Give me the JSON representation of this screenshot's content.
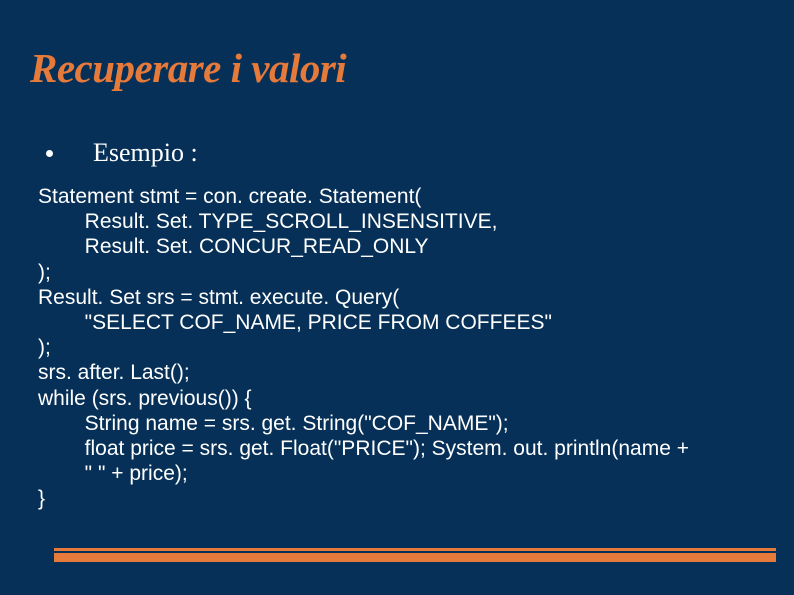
{
  "title": "Recuperare i valori",
  "bullet": "Esempio :",
  "code": "Statement stmt = con. create. Statement(\n        Result. Set. TYPE_SCROLL_INSENSITIVE,\n        Result. Set. CONCUR_READ_ONLY\n);\nResult. Set srs = stmt. execute. Query(\n        \"SELECT COF_NAME, PRICE FROM COFFEES\"\n);\nsrs. after. Last();\nwhile (srs. previous()) {\n        String name = srs. get. String(\"COF_NAME\");\n        float price = srs. get. Float(\"PRICE\"); System. out. println(name +\n        \" \" + price);\n}"
}
